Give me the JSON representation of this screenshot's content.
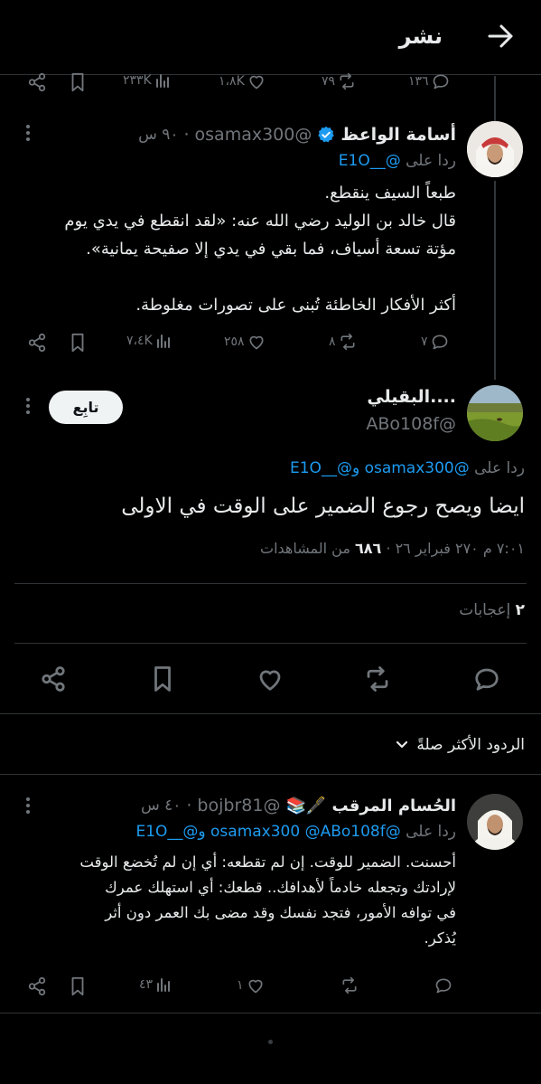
{
  "header": {
    "title": "نشر"
  },
  "top_action_bar": {
    "replies": "١٣٦",
    "reposts": "٧٩",
    "likes": "١،٨K",
    "views": "٢٣٣K"
  },
  "reply_tweet_1": {
    "author_name": "أسامة الواعظ",
    "handle": "@osamax300",
    "time": "٩٠ س",
    "replying_prefix": "ردا على",
    "replying_to": "@__E1O",
    "body": [
      "طبعاً السيف ينقطع.",
      "قال خالد بن الوليد رضي الله عنه: «لقد انقطع في يدي يوم",
      "مؤتة تسعة أسياف، فما بقي في يدي إلا صفيحة يمانية».",
      "",
      "أكثر الأفكار الخاطئة تُبنى على تصورات مغلوطة."
    ],
    "replies": "٧",
    "reposts": "٨",
    "likes": "٢٥٨",
    "views": "٧،٤K"
  },
  "main_tweet": {
    "author_name": "....البقيلي",
    "handle": "@ABo108f",
    "follow_label": "تابِع",
    "replying_prefix": "ردا على",
    "replying_to": "@osamax300 و@__E1O",
    "body": "ايضا ويصح رجوع الضمير على الوقت في الاولى",
    "meta_time_date": "٧:٠١ م ٢٧٠ فبراير ٢٦ ·",
    "meta_views": "٦٨٦",
    "meta_views_label": "من المشاهدات",
    "likes_count": "٢",
    "likes_label": "إعجابات"
  },
  "sort": {
    "label": "الردود الأكثر صلةً"
  },
  "reply_tweet_2": {
    "author_name": "الحُسام المرقب 🖋️📚",
    "handle": "@bojbr81",
    "time": "٤٠ س",
    "replying_prefix": "ردا على",
    "replying_to": "@osamax300 @ABo108f و@__E1O",
    "body": [
      "أحسنت. الضمير للوقت. إن لم تقطعه: أي إن لم تُخضع الوقت",
      "لإرادتك وتجعله خادماً لأهدافك.. قطعك: أي استهلك عمرك",
      "في توافه الأمور، فتجد نفسك وقد مضى بك العمر دون أثر",
      "يُذكر."
    ],
    "replies": "",
    "reposts": "",
    "likes": "١",
    "views": "٤٣"
  },
  "colors": {
    "background": "#000000",
    "text": "#e7e9ea",
    "muted": "#71767b",
    "link": "#1d9bf0",
    "divider": "#2f3336",
    "verified": "#1d9bf0"
  }
}
